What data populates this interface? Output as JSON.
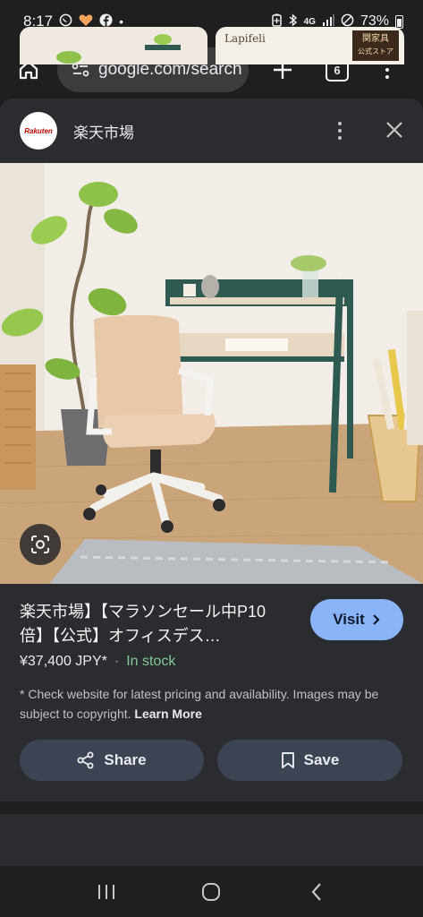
{
  "status_bar": {
    "time": "8:17",
    "left_icons": [
      "whatsapp-icon",
      "heart-app-icon",
      "facebook-icon",
      "dot-icon"
    ],
    "right_icons": [
      "battery-saver-icon",
      "bluetooth-icon",
      "4g-icon",
      "signal-icon",
      "dnd-icon",
      "battery-icon"
    ],
    "network": "4G",
    "battery_percent": "73%"
  },
  "browser": {
    "url": "google.com/search",
    "tab_count": "6"
  },
  "sheet": {
    "site_name": "楽天市場",
    "logo_text": "Rakuten"
  },
  "product": {
    "title": "楽天市場】【マラソンセール中P10倍】【公式】オフィスデス…",
    "visit_label": "Visit",
    "price": "¥37,400 JPY*",
    "separator": "·",
    "stock_status": "In stock",
    "disclaimer": "* Check website for latest pricing and availability. Images may be subject to copyright.",
    "learn_more": "Learn More",
    "share_label": "Share",
    "save_label": "Save"
  },
  "gallery": {
    "right_thumb_brand": "Lapifeli",
    "right_thumb_badge_line1": "関家具",
    "right_thumb_badge_line2": "公式ストア"
  },
  "colors": {
    "background": "#1f1f21",
    "sheet": "#2b2c2f",
    "accent_button": "#8ab4f8",
    "in_stock": "#81c995",
    "action_button": "#3c4454"
  }
}
